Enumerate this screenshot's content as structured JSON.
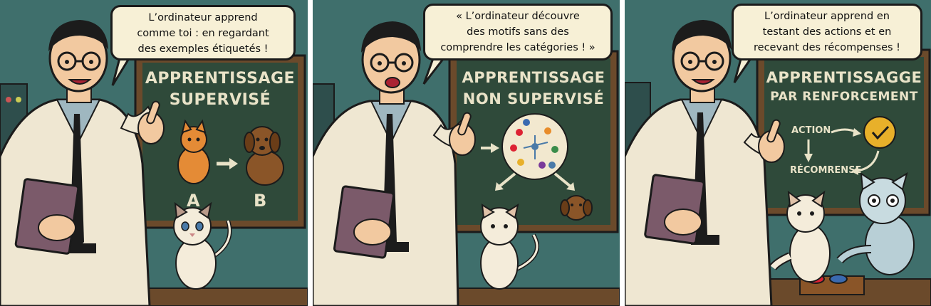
{
  "panels": [
    {
      "speech": [
        "L’ordinateur apprend",
        "comme toi : en regardant",
        "des exemples étiquetés !"
      ],
      "board_title": [
        "APPRENTISSAGE",
        "SUPERVISÉ"
      ],
      "labels": {
        "a": "A",
        "b": "B"
      }
    },
    {
      "speech": [
        "« L’ordinateur découvre",
        "des motifs sans des",
        "comprendre les catégories ! »"
      ],
      "board_title": [
        "APPRENTISSAGE",
        "NON SUPERVISÉ"
      ]
    },
    {
      "speech": [
        "L’ordinateur apprend en",
        "testant des actions et en",
        "recevant des récompenses !"
      ],
      "board_title": [
        "APPRENTISSAGGE",
        "PAR RENFORCEMENT"
      ],
      "labels": {
        "action": "ACTION",
        "reward": "RÉCOMRENSE"
      }
    }
  ],
  "colors": {
    "wall": "#3f6f6c",
    "board": "#2f4a3a",
    "frame": "#6b4a2b",
    "bubble": "#f7f0d6",
    "chalk": "#e9e3c8"
  }
}
